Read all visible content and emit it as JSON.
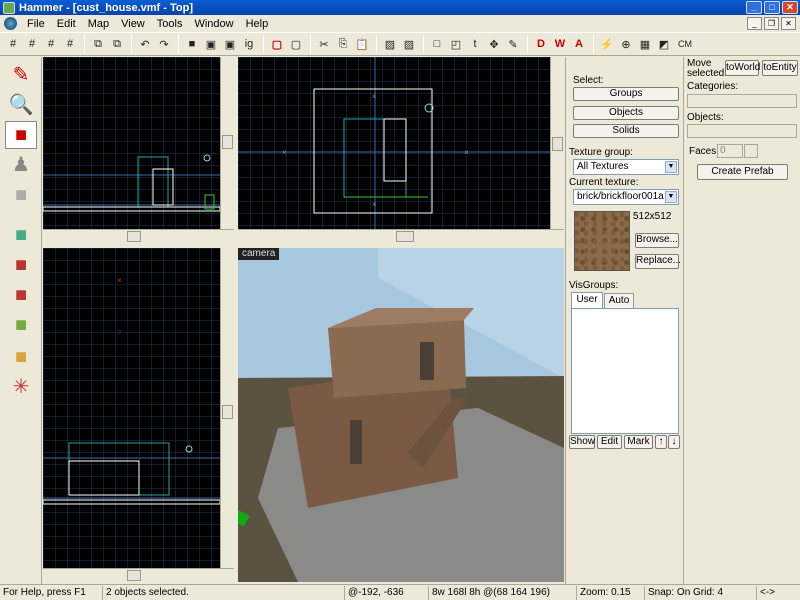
{
  "window": {
    "title": "Hammer - [cust_house.vmf - Top]"
  },
  "menu": [
    "File",
    "Edit",
    "Map",
    "View",
    "Tools",
    "Window",
    "Help"
  ],
  "toolbar": {
    "ig_label": "ig",
    "cm_label": "CM"
  },
  "viewports": {
    "camera_label": "camera"
  },
  "texture_panel": {
    "select_label": "Select:",
    "groups_button": "Groups",
    "objects_button": "Objects",
    "solids_button": "Solids",
    "texture_group_label": "Texture group:",
    "texture_group_value": "All Textures",
    "current_texture_label": "Current texture:",
    "current_texture_value": "brick/brickfloor001a",
    "texture_size": "512x512",
    "browse_button": "Browse...",
    "replace_button": "Replace...",
    "visgroups_label": "VisGroups:",
    "tab_user": "User",
    "tab_auto": "Auto",
    "show_button": "Show",
    "edit_button": "Edit",
    "mark_button": "Mark",
    "up_button": "↑",
    "down_button": "↓"
  },
  "right_panel": {
    "move_selected_label": "Move selected:",
    "to_world_button": "toWorld",
    "to_entity_button": "toEntity",
    "categories_label": "Categories:",
    "objects_label": "Objects:",
    "faces_label": "Faces:",
    "faces_value": "0",
    "create_prefab_button": "Create Prefab"
  },
  "status": {
    "help": "For Help, press F1",
    "selection": "2 objects selected.",
    "coords": "@-192, -636",
    "size": "8w 168l 8h @(68 164 196)",
    "zoom": "Zoom: 0.15",
    "snap": "Snap: On Grid: 4",
    "extra": "<->"
  },
  "colors": {
    "titlebar": "#0a5fd6",
    "grid": "#1c3d5c",
    "viewport_bg": "#000000",
    "sky": "#8fb7d4"
  }
}
